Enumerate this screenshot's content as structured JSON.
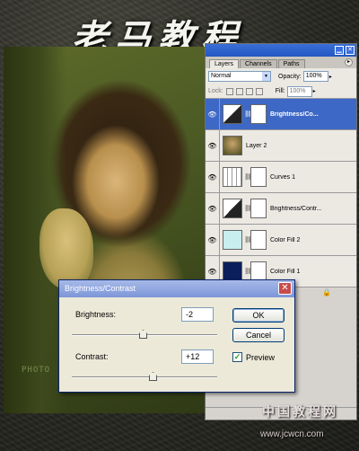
{
  "watermark": {
    "title_cn": "老马教程",
    "photo_mark": "PHOTO",
    "site_cn": "中国教程网",
    "site_url": "www.jcwcn.com"
  },
  "layers_panel": {
    "tabs": [
      {
        "label": "Layers",
        "active": true
      },
      {
        "label": "Channels",
        "active": false
      },
      {
        "label": "Paths",
        "active": false
      }
    ],
    "blend_mode": "Normal",
    "opacity_label": "Opacity:",
    "opacity_value": "100%",
    "lock_label": "Lock:",
    "fill_label": "Fill:",
    "fill_value": "100%",
    "layers": [
      {
        "name": "Brightness/Co...",
        "selected": true,
        "thumb": "adjust-brightness",
        "has_mask": true
      },
      {
        "name": "Layer 2",
        "selected": false,
        "thumb": "photo",
        "has_mask": false
      },
      {
        "name": "Curves 1",
        "selected": false,
        "thumb": "adjust-curves",
        "has_mask": true
      },
      {
        "name": "Brightness/Contr...",
        "selected": false,
        "thumb": "adjust-brightness",
        "has_mask": true
      },
      {
        "name": "Color Fill 2",
        "selected": false,
        "thumb": "color",
        "color": "#c8eef0",
        "has_mask": true
      },
      {
        "name": "Color Fill 1",
        "selected": false,
        "thumb": "color",
        "color": "#0b1f5c",
        "has_mask": true
      }
    ]
  },
  "dialog": {
    "title": "Brightness/Contrast",
    "brightness_label": "Brightness:",
    "brightness_value": "-2",
    "contrast_label": "Contrast:",
    "contrast_value": "+12",
    "ok_label": "OK",
    "cancel_label": "Cancel",
    "preview_label": "Preview",
    "preview_checked": true
  },
  "colors": {
    "selected_layer": "#3d68c6",
    "dialog_title": "#7c96d8",
    "close_button": "#c74b4b"
  }
}
